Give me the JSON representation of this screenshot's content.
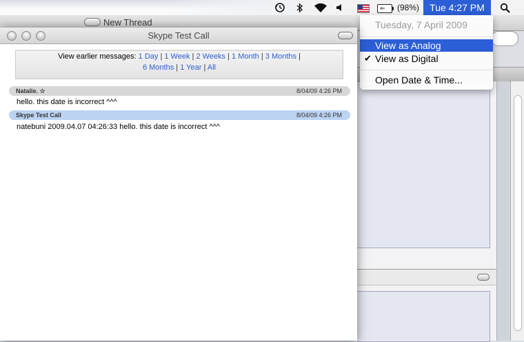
{
  "background_window": {
    "title": "New Thread"
  },
  "menubar": {
    "icons": [
      "time-machine-icon",
      "bluetooth-icon",
      "wifi-icon",
      "volume-icon",
      "us-flag-icon",
      "battery-icon",
      "spotlight-icon"
    ],
    "battery_percent": "(98%)",
    "clock": "Tue 4:27 PM"
  },
  "clock_menu": {
    "date_label": "Tuesday, 7 April 2009",
    "items": [
      {
        "label": "View as Analog",
        "selected": true,
        "checked": false
      },
      {
        "label": "View as Digital",
        "selected": false,
        "checked": true
      },
      {
        "label": "Open Date & Time...",
        "selected": false,
        "checked": false
      }
    ],
    "check_glyph": "✔"
  },
  "skype_window": {
    "title": "Skype Test Call",
    "earlier": {
      "prefix": "View earlier messages:",
      "links": [
        "1 Day",
        "1 Week",
        "2 Weeks",
        "1 Month",
        "3 Months",
        "6 Months",
        "1 Year",
        "All"
      ],
      "separator": "|"
    },
    "messages": [
      {
        "sender": "Natalie. ☆",
        "timestamp": "8/04/09 4:26 PM",
        "text": "hello. this date is incorrect ^^^",
        "style": "gray"
      },
      {
        "sender": "Skype Test Call",
        "timestamp": "8/04/09 4:26 PM",
        "text": "natebuni 2009.04.07 04:26:33 hello. this date is incorrect ^^^",
        "style": "blue"
      }
    ]
  },
  "colors": {
    "selection_blue": "#2c5fd6",
    "link_blue": "#2b5fd0",
    "msg_header_gray": "#d7d7d7",
    "msg_header_blue": "#bcd3f2"
  }
}
